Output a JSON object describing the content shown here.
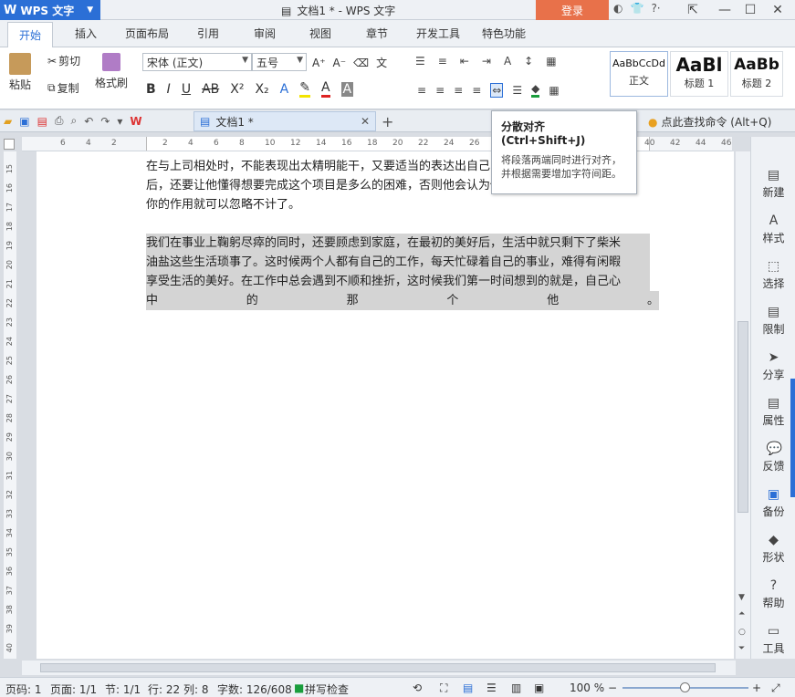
{
  "titlebar": {
    "app_name": "WPS 文字",
    "doc_title": "文档1 * - WPS 文字",
    "login": "登录"
  },
  "tabs": [
    "开始",
    "插入",
    "页面布局",
    "引用",
    "审阅",
    "视图",
    "章节",
    "开发工具",
    "特色功能"
  ],
  "ribbon": {
    "clipboard": {
      "paste": "粘贴",
      "cut": "剪切",
      "copy": "复制",
      "format_painter": "格式刷"
    },
    "font": {
      "name": "宋体 (正文)",
      "size": "五号"
    },
    "styles": [
      {
        "sample": "AaBbCcDd",
        "name": "正文"
      },
      {
        "sample": "AaBl",
        "name": "标题 1"
      },
      {
        "sample": "AaBb",
        "name": "标题 2"
      }
    ]
  },
  "quickbar": {
    "doc_tab": "文档1 *",
    "find_command": "点此查找命令 (Alt+Q)"
  },
  "tooltip": {
    "title": "分散对齐 (Ctrl+Shift+J)",
    "desc": "将段落两端同时进行对齐，并根据需要增加字符间距。"
  },
  "ruler": {
    "h_ticks": [
      "6",
      "4",
      "2",
      "2",
      "4",
      "6",
      "8",
      "10",
      "12",
      "14",
      "16",
      "18",
      "20",
      "22",
      "24",
      "26",
      "40",
      "42",
      "44",
      "46"
    ],
    "v_ticks": [
      "15",
      "16",
      "17",
      "18",
      "19",
      "20",
      "21",
      "22",
      "23",
      "24",
      "25",
      "26",
      "27",
      "28",
      "29",
      "30",
      "31",
      "32",
      "33",
      "34",
      "35",
      "36",
      "37",
      "38",
      "39",
      "40"
    ]
  },
  "document": {
    "para1_lines": [
      "在与上司相处时，不能表现出太精明能干，又要适当的表达出自己的能力，在对待每个项目",
      "后，还要让他懂得想要完成这个项目是多么的困难，否则他会认为你是可有可无的，那么",
      "你的作用就可以忽略不计了。"
    ],
    "para2_lines": [
      "我们在事业上鞠躬尽瘁的同时，还要顾虑到家庭，在最初的美好后，生活中就只剩下了柴米",
      "油盐这些生活琐事了。这时候两个人都有自己的工作，每天忙碌着自己的事业，难得有闲暇",
      "享受生活的美好。在工作中总会遇到不顺和挫折，这时候我们第一时间想到的就是，自己心"
    ],
    "para2_last_chars": [
      "中",
      "的",
      "那",
      "个",
      "他",
      "。"
    ]
  },
  "sidebar": [
    "新建",
    "样式",
    "选择",
    "限制",
    "分享",
    "属性",
    "反馈",
    "备份",
    "形状",
    "帮助",
    "工具"
  ],
  "status": {
    "page": "页码: 1",
    "pages": "页面: 1/1",
    "section": "节: 1/1",
    "row": "行: 22",
    "col": "列: 8",
    "words": "字数: 126/608",
    "spell": "拼写检查",
    "zoom": "100 %"
  },
  "colors": {
    "accent": "#2b6fd6",
    "login_bg": "#e8714a",
    "highlight": "#d4d4d4"
  }
}
